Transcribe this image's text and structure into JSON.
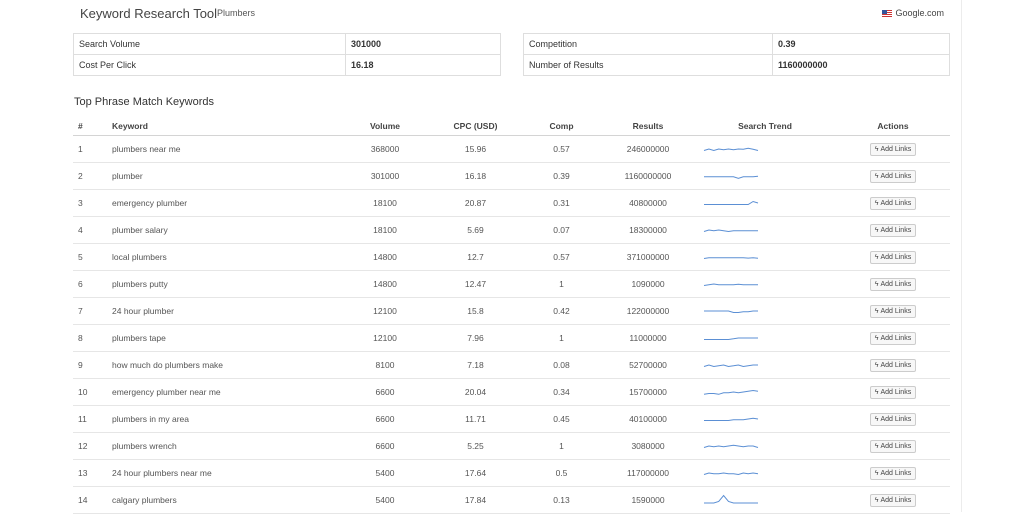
{
  "header": {
    "title": "Keyword Research Tool",
    "subtitle": "Plumbers",
    "source": "Google.com"
  },
  "stats": {
    "search_volume_label": "Search Volume",
    "search_volume": "301000",
    "cpc_label": "Cost Per Click",
    "cpc": "16.18",
    "competition_label": "Competition",
    "competition": "0.39",
    "results_label": "Number of Results",
    "results": "1160000000"
  },
  "section_title": "Top Phrase Match Keywords",
  "table": {
    "headers": {
      "num": "#",
      "keyword": "Keyword",
      "volume": "Volume",
      "cpc": "CPC (USD)",
      "comp": "Comp",
      "results": "Results",
      "trend": "Search Trend",
      "actions": "Actions"
    },
    "button_label": "Add Links",
    "trend_color": "#5b8fd4",
    "rows": [
      {
        "n": "1",
        "keyword": "plumbers near me",
        "volume": "368000",
        "cpc": "15.96",
        "comp": "0.57",
        "results": "246000000",
        "trend": [
          3,
          4,
          3,
          4,
          3.5,
          4,
          3.5,
          4,
          3.8,
          4.5,
          3.8,
          3
        ]
      },
      {
        "n": "2",
        "keyword": "plumber",
        "volume": "301000",
        "cpc": "16.18",
        "comp": "0.39",
        "results": "1160000000",
        "trend": [
          3.5,
          3.5,
          3.5,
          3.5,
          3.5,
          3.5,
          3.5,
          2.5,
          3.5,
          3.5,
          3.5,
          3.8
        ]
      },
      {
        "n": "3",
        "keyword": "emergency plumber",
        "volume": "18100",
        "cpc": "20.87",
        "comp": "0.31",
        "results": "40800000",
        "trend": [
          3,
          3,
          3,
          3,
          3,
          3,
          3,
          3,
          3,
          3,
          5,
          4
        ]
      },
      {
        "n": "4",
        "keyword": "plumber salary",
        "volume": "18100",
        "cpc": "5.69",
        "comp": "0.07",
        "results": "18300000",
        "trend": [
          3,
          4,
          3.5,
          4,
          3.5,
          3,
          3.5,
          3.5,
          3.5,
          3.5,
          3.5,
          3.5
        ]
      },
      {
        "n": "5",
        "keyword": "local plumbers",
        "volume": "14800",
        "cpc": "12.7",
        "comp": "0.57",
        "results": "371000000",
        "trend": [
          3,
          3.5,
          3.5,
          3.5,
          3.5,
          3.5,
          3.5,
          3.5,
          3.5,
          3.3,
          3.5,
          3.2
        ]
      },
      {
        "n": "6",
        "keyword": "plumbers putty",
        "volume": "14800",
        "cpc": "12.47",
        "comp": "1",
        "results": "1090000",
        "trend": [
          3,
          3.5,
          4,
          3.5,
          3.5,
          3.5,
          3.5,
          3.8,
          3.5,
          3.5,
          3.5,
          3.5
        ]
      },
      {
        "n": "7",
        "keyword": "24 hour plumber",
        "volume": "12100",
        "cpc": "15.8",
        "comp": "0.42",
        "results": "122000000",
        "trend": [
          4,
          4,
          4,
          4,
          4,
          4,
          3,
          3,
          3.5,
          3.5,
          4,
          4
        ]
      },
      {
        "n": "8",
        "keyword": "plumbers tape",
        "volume": "12100",
        "cpc": "7.96",
        "comp": "1",
        "results": "11000000",
        "trend": [
          3,
          3,
          3,
          3,
          3,
          3,
          3.5,
          4,
          4,
          4,
          4,
          4
        ]
      },
      {
        "n": "9",
        "keyword": "how much do plumbers make",
        "volume": "8100",
        "cpc": "7.18",
        "comp": "0.08",
        "results": "52700000",
        "trend": [
          3,
          4,
          3,
          3.5,
          4,
          3,
          3.5,
          4,
          3,
          3.5,
          4,
          4
        ]
      },
      {
        "n": "10",
        "keyword": "emergency plumber near me",
        "volume": "6600",
        "cpc": "20.04",
        "comp": "0.34",
        "results": "15700000",
        "trend": [
          2.5,
          3,
          3,
          2.5,
          3.5,
          3.5,
          4,
          3.5,
          4,
          4.5,
          5,
          4.5
        ]
      },
      {
        "n": "11",
        "keyword": "plumbers in my area",
        "volume": "6600",
        "cpc": "11.71",
        "comp": "0.45",
        "results": "40100000",
        "trend": [
          3,
          3,
          3,
          3,
          3,
          3,
          3.5,
          3.5,
          3.5,
          4,
          4.5,
          4
        ]
      },
      {
        "n": "12",
        "keyword": "plumbers wrench",
        "volume": "6600",
        "cpc": "5.25",
        "comp": "1",
        "results": "3080000",
        "trend": [
          3,
          4,
          3.5,
          4,
          3.5,
          4,
          4.5,
          4,
          3.5,
          4,
          4,
          3
        ]
      },
      {
        "n": "13",
        "keyword": "24 hour plumbers near me",
        "volume": "5400",
        "cpc": "17.64",
        "comp": "0.5",
        "results": "117000000",
        "trend": [
          3,
          4,
          3.5,
          3.5,
          4,
          3.5,
          3.5,
          3,
          4,
          3.5,
          4,
          3.5
        ]
      },
      {
        "n": "14",
        "keyword": "calgary plumbers",
        "volume": "5400",
        "cpc": "17.84",
        "comp": "0.13",
        "results": "1590000",
        "trend": [
          2,
          2,
          2,
          3,
          7,
          3,
          2,
          2,
          2,
          2,
          2,
          2
        ]
      }
    ]
  }
}
